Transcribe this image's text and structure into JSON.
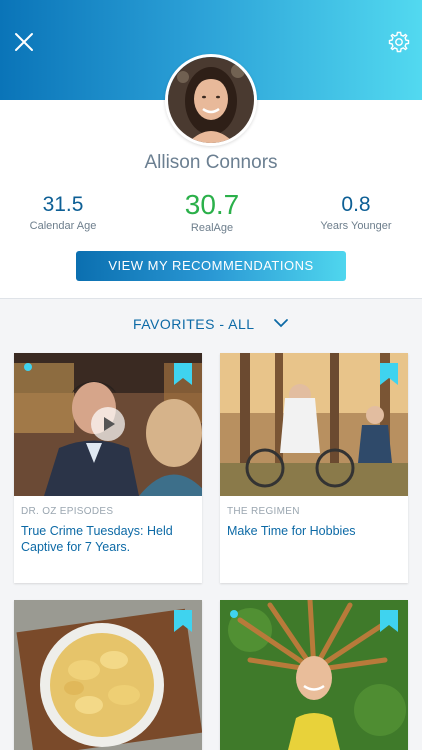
{
  "colors": {
    "accent": "#0d6aa6",
    "gradient_start": "#0a74b8",
    "gradient_end": "#52d9f0",
    "realage": "#2bb04a",
    "new_dot": "#3fd3ef"
  },
  "header": {
    "close_icon": "close-icon",
    "settings_icon": "gear-icon"
  },
  "profile": {
    "name": "Allison Connors",
    "stats": [
      {
        "value": "31.5",
        "label": "Calendar Age"
      },
      {
        "value": "30.7",
        "label": "RealAge"
      },
      {
        "value": "0.8",
        "label": "Years Younger"
      }
    ],
    "recommendations_button": "VIEW MY RECOMMENDATIONS"
  },
  "favorites": {
    "filter_label": "FAVORITES - ALL",
    "cards": [
      {
        "category": "DR. OZ EPISODES",
        "title": "True Crime Tuesdays: Held Captive for 7 Years.",
        "is_new": true,
        "has_video": true
      },
      {
        "category": "THE REGIMEN",
        "title": "Make Time for Hobbies",
        "is_new": false,
        "has_video": false
      },
      {
        "category": "",
        "title": "",
        "is_new": false,
        "has_video": false
      },
      {
        "category": "",
        "title": "",
        "is_new": true,
        "has_video": false
      }
    ]
  }
}
